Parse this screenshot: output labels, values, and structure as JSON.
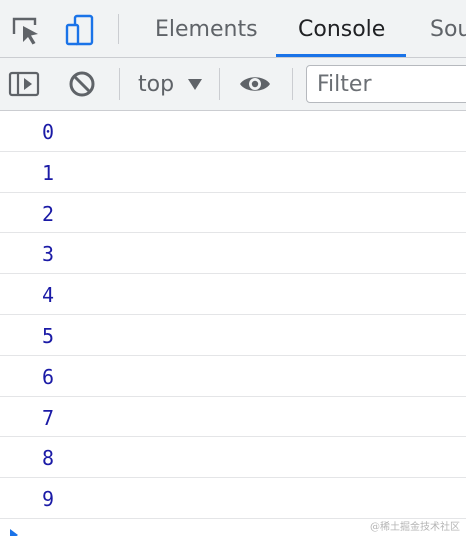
{
  "tabs": [
    {
      "label": "Elements",
      "active": false
    },
    {
      "label": "Console",
      "active": true
    },
    {
      "label": "Sou",
      "active": false
    }
  ],
  "toolbar": {
    "context": "top",
    "filter_placeholder": "Filter"
  },
  "icons": {
    "inspect": "inspect-element-icon",
    "device": "device-toolbar-icon",
    "sidebar": "show-sidebar-icon",
    "clear": "clear-console-icon",
    "eye": "live-expression-eye-icon",
    "prompt": "console-prompt-icon"
  },
  "colors": {
    "accent": "#1a73e8",
    "value": "#1a1aa6",
    "toolbar_bg": "#f1f3f4"
  },
  "console": {
    "messages": [
      "0",
      "1",
      "2",
      "3",
      "4",
      "5",
      "6",
      "7",
      "8",
      "9"
    ]
  },
  "watermark": "@稀土掘金技术社区"
}
